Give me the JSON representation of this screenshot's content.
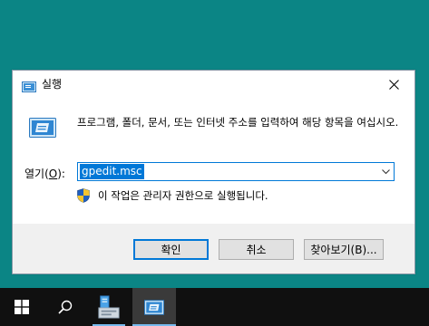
{
  "dialog": {
    "title": "실행",
    "description": "프로그램, 폴더, 문서, 또는 인터넷 주소를 입력하여 해당 항목을 여십시오.",
    "open_label_prefix": "열기(",
    "open_label_key": "O",
    "open_label_suffix": "):",
    "command_value": "gpedit.msc",
    "uac_message": "이 작업은 관리자 권한으로 실행됩니다.",
    "buttons": {
      "ok": "확인",
      "cancel": "취소",
      "browse": "찾아보기(B)..."
    }
  },
  "taskbar": {
    "items": [
      "start-icon",
      "search-icon",
      "file-explorer-icon",
      "run-icon"
    ]
  },
  "colors": {
    "desktop": "#0b8585",
    "accent": "#0078d7",
    "taskbar": "#101010",
    "footer": "#f0f0f0"
  }
}
